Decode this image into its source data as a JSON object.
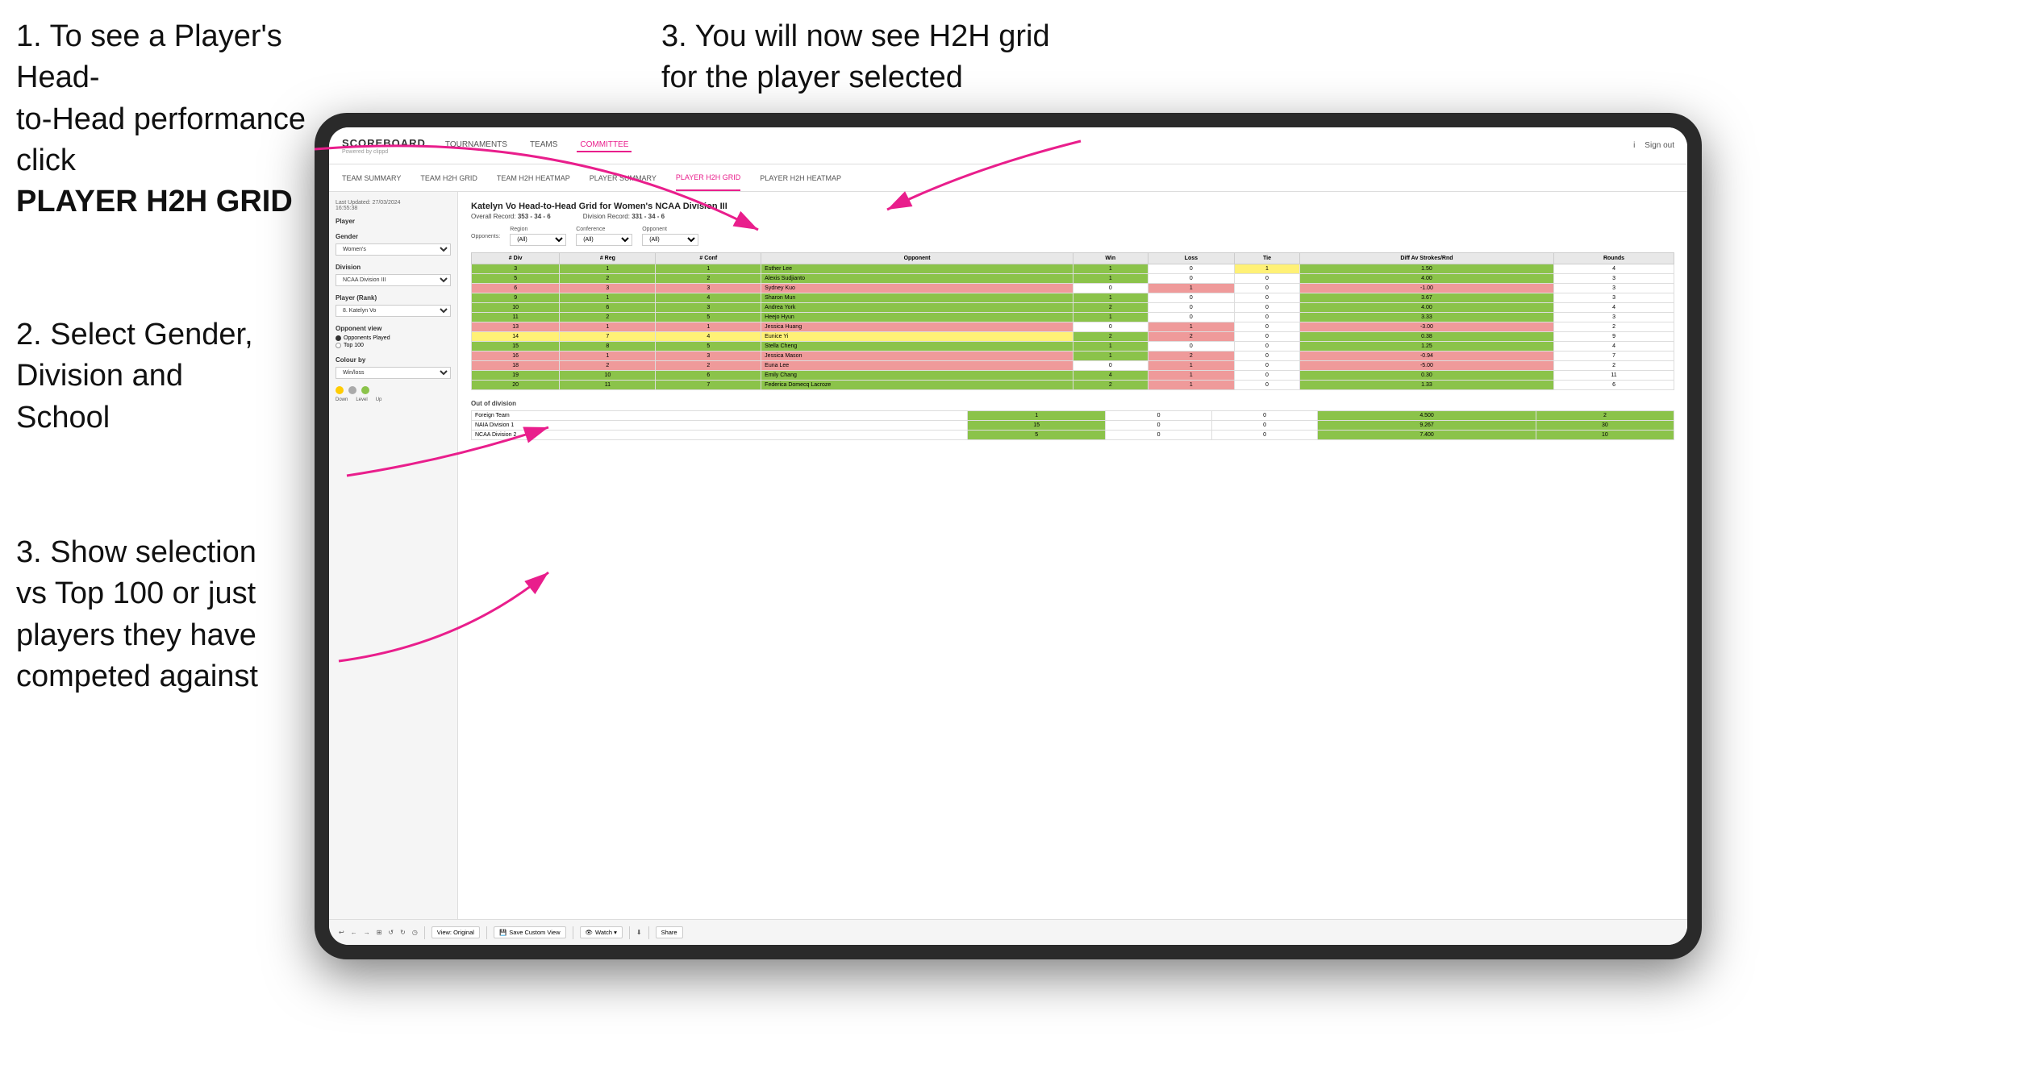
{
  "instructions": {
    "top_left_1": "1. To see a Player's Head-",
    "top_left_2": "to-Head performance click",
    "top_left_bold": "PLAYER H2H GRID",
    "top_right_1": "3. You will now see H2H grid",
    "top_right_2": "for the player selected",
    "mid_left_1": "2. Select Gender,",
    "mid_left_2": "Division and",
    "mid_left_3": "School",
    "bot_left_1": "3. Show selection",
    "bot_left_2": "vs Top 100 or just",
    "bot_left_3": "players they have",
    "bot_left_4": "competed against"
  },
  "nav": {
    "logo": "SCOREBOARD",
    "logo_sub": "Powered by clippd",
    "items": [
      "TOURNAMENTS",
      "TEAMS",
      "COMMITTEE"
    ],
    "right": [
      "i",
      "Sign out"
    ]
  },
  "sub_nav": {
    "items": [
      "TEAM SUMMARY",
      "TEAM H2H GRID",
      "TEAM H2H HEATMAP",
      "PLAYER SUMMARY",
      "PLAYER H2H GRID",
      "PLAYER H2H HEATMAP"
    ]
  },
  "left_panel": {
    "timestamp": "Last Updated: 27/03/2024",
    "timestamp2": "16:55:38",
    "player_label": "Player",
    "gender_label": "Gender",
    "gender_value": "Women's",
    "division_label": "Division",
    "division_value": "NCAA Division III",
    "player_rank_label": "Player (Rank)",
    "player_rank_value": "8. Katelyn Vo",
    "opponent_view_label": "Opponent view",
    "radio1": "Opponents Played",
    "radio2": "Top 100",
    "colour_label": "Colour by",
    "colour_value": "Win/loss",
    "colour_legend": [
      "Down",
      "Level",
      "Up"
    ]
  },
  "data_panel": {
    "title": "Katelyn Vo Head-to-Head Grid for Women's NCAA Division III",
    "overall_record_label": "Overall Record:",
    "overall_record": "353 - 34 - 6",
    "division_record_label": "Division Record:",
    "division_record": "331 - 34 - 6",
    "filters": {
      "opponents_label": "Opponents:",
      "region_label": "Region",
      "conference_label": "Conference",
      "opponent_label": "Opponent",
      "region_value": "(All)",
      "conference_value": "(All)",
      "opponent_value": "(All)"
    },
    "table_headers": [
      "# Div",
      "# Reg",
      "# Conf",
      "Opponent",
      "Win",
      "Loss",
      "Tie",
      "Diff Av Strokes/Rnd",
      "Rounds"
    ],
    "rows": [
      {
        "div": "3",
        "reg": "1",
        "conf": "1",
        "opponent": "Esther Lee",
        "win": 1,
        "loss": 0,
        "tie": 1,
        "diff": 1.5,
        "rounds": 4,
        "color": "green"
      },
      {
        "div": "5",
        "reg": "2",
        "conf": "2",
        "opponent": "Alexis Sudjianto",
        "win": 1,
        "loss": 0,
        "tie": 0,
        "diff": 4.0,
        "rounds": 3,
        "color": "green"
      },
      {
        "div": "6",
        "reg": "3",
        "conf": "3",
        "opponent": "Sydney Kuo",
        "win": 0,
        "loss": 1,
        "tie": 0,
        "diff": -1.0,
        "rounds": 3,
        "color": "red"
      },
      {
        "div": "9",
        "reg": "1",
        "conf": "4",
        "opponent": "Sharon Mun",
        "win": 1,
        "loss": 0,
        "tie": 0,
        "diff": 3.67,
        "rounds": 3,
        "color": "green"
      },
      {
        "div": "10",
        "reg": "6",
        "conf": "3",
        "opponent": "Andrea York",
        "win": 2,
        "loss": 0,
        "tie": 0,
        "diff": 4.0,
        "rounds": 4,
        "color": "green"
      },
      {
        "div": "11",
        "reg": "2",
        "conf": "5",
        "opponent": "Heejo Hyun",
        "win": 1,
        "loss": 0,
        "tie": 0,
        "diff": 3.33,
        "rounds": 3,
        "color": "green"
      },
      {
        "div": "13",
        "reg": "1",
        "conf": "1",
        "opponent": "Jessica Huang",
        "win": 0,
        "loss": 1,
        "tie": 0,
        "diff": -3.0,
        "rounds": 2,
        "color": "red"
      },
      {
        "div": "14",
        "reg": "7",
        "conf": "4",
        "opponent": "Eunice Yi",
        "win": 2,
        "loss": 2,
        "tie": 0,
        "diff": 0.38,
        "rounds": 9,
        "color": "yellow"
      },
      {
        "div": "15",
        "reg": "8",
        "conf": "5",
        "opponent": "Stella Cheng",
        "win": 1,
        "loss": 0,
        "tie": 0,
        "diff": 1.25,
        "rounds": 4,
        "color": "green"
      },
      {
        "div": "16",
        "reg": "1",
        "conf": "3",
        "opponent": "Jessica Mason",
        "win": 1,
        "loss": 2,
        "tie": 0,
        "diff": -0.94,
        "rounds": 7,
        "color": "red"
      },
      {
        "div": "18",
        "reg": "2",
        "conf": "2",
        "opponent": "Euna Lee",
        "win": 0,
        "loss": 1,
        "tie": 0,
        "diff": -5.0,
        "rounds": 2,
        "color": "red"
      },
      {
        "div": "19",
        "reg": "10",
        "conf": "6",
        "opponent": "Emily Chang",
        "win": 4,
        "loss": 1,
        "tie": 0,
        "diff": 0.3,
        "rounds": 11,
        "color": "green"
      },
      {
        "div": "20",
        "reg": "11",
        "conf": "7",
        "opponent": "Federica Domecq Lacroze",
        "win": 2,
        "loss": 1,
        "tie": 0,
        "diff": 1.33,
        "rounds": 6,
        "color": "green"
      }
    ],
    "out_of_division_label": "Out of division",
    "out_of_division_rows": [
      {
        "name": "Foreign Team",
        "win": 1,
        "loss": 0,
        "tie": 0,
        "diff": 4.5,
        "rounds": 2
      },
      {
        "name": "NAIA Division 1",
        "win": 15,
        "loss": 0,
        "tie": 0,
        "diff": 9.267,
        "rounds": 30
      },
      {
        "name": "NCAA Division 2",
        "win": 5,
        "loss": 0,
        "tie": 0,
        "diff": 7.4,
        "rounds": 10
      }
    ]
  },
  "toolbar": {
    "buttons": [
      "↩",
      "←",
      "→",
      "⊞",
      "↺",
      "↻",
      "◷"
    ],
    "view_original": "View: Original",
    "save_custom": "Save Custom View",
    "watch": "Watch ▾",
    "share": "Share"
  }
}
